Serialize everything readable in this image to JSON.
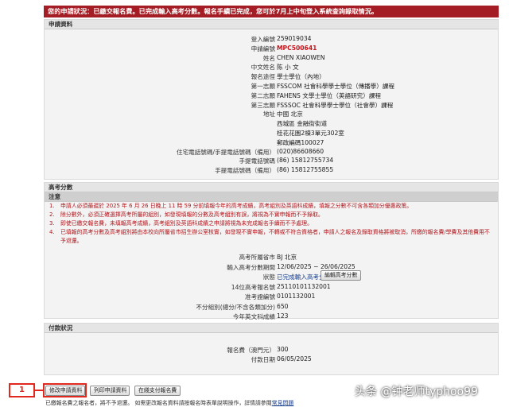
{
  "banner": "您的申請狀況：已繳交報名費。已完成輸入高考分數。報名手續已完成，您可於7月上中旬登入系統查詢錄取情況。",
  "application": {
    "header": "申請資料",
    "rows": [
      {
        "label": "登入編號",
        "value": "259019034"
      },
      {
        "label": "申請編號",
        "value": "MPC500641"
      },
      {
        "label": "姓名",
        "value": "CHEN XIAOWEN"
      },
      {
        "label": "中文姓名",
        "value": "陈 小 文"
      },
      {
        "label": "報名途徑",
        "value": "學士學位（內地）"
      },
      {
        "label": "第一志願",
        "value": "FSSCOM 社會科學學士學位（傳播學）課程"
      },
      {
        "label": "第二志願",
        "value": "FAHENS 文學士學位（英語研究）課程"
      },
      {
        "label": "第三志願",
        "value": "FSSSOC 社會科學學士學位（社會學）課程"
      },
      {
        "label": "地址",
        "value": "中國 北京"
      },
      {
        "label": "",
        "value": "西城區 金融街街道"
      },
      {
        "label": "",
        "value": "桂花花園2棟3單元302室"
      },
      {
        "label": "",
        "value": "郵政編碼100027"
      },
      {
        "label": "住宅電話號碼/手提電話號碼（備用）",
        "value": "(020)86608660"
      },
      {
        "label": "手提電話號碼",
        "value": "(86) 15812755734"
      },
      {
        "label": "手提電話號碼（備用）",
        "value": "(86) 15812755855"
      }
    ]
  },
  "gaokao": {
    "header": "高考分數",
    "notes_header": "注意",
    "notes": [
      {
        "num": "1.",
        "text": "申請人必須最遲於 2025 年 6 月 26 日晚上 11 時 59 分前填報今年的高考成績，高考組別及英語科成績，填報之分數不可含各類加分優惠政策。"
      },
      {
        "num": "2.",
        "text": "除分數外，必須正確選擇高考所屬的組別，如發現填報的分數及高考組別有誤，將視為不實申報而不予錄取。"
      },
      {
        "num": "3.",
        "text": "即使已繳交報名費，未填報高考成績，高考組別及英語科成績之申請將視為未完成報名手續而不予處理。"
      },
      {
        "num": "4.",
        "text": "已填報的高考分數及高考組別將由本校向所屬省市招生辦公室核實，如發現不實申報，不轉或不符合資格者，申請人之報名及錄取資格將被取消，所繳的報名費/學費及其他費用不予退還。"
      }
    ],
    "rows": [
      {
        "label": "高考所屬省市",
        "value": "BJ 北京"
      },
      {
        "label": "輸入高考分數期間",
        "value": "12/06/2025 ~ 26/06/2025"
      },
      {
        "label": "狀態",
        "value": "已完成輸入高考分數"
      },
      {
        "label": "14位高考報名號",
        "value": "25110101132001"
      },
      {
        "label": "准考證編號",
        "value": "0101132001"
      },
      {
        "label": "不分組別(總分/不含各類加分)",
        "value": "650"
      },
      {
        "label": "今年英文科成績",
        "value": "123"
      }
    ],
    "edit_button": "編輯高考分數"
  },
  "payment": {
    "header": "付款狀況",
    "rows": [
      {
        "label": "報名費（澳門元）",
        "value": "300"
      },
      {
        "label": "付款日期",
        "value": "06/05/2025"
      }
    ]
  },
  "buttons": {
    "edit_application": "修改申請資料",
    "print_application": "列印申請資料",
    "online_payment": "在綫支付報名費"
  },
  "footer": {
    "text": "已繳報名費之報名者，將不予退還。 如需更改報名資料請按報名時表單說明操作，詳情請參閱",
    "link": "常見問題"
  },
  "callout_label": "1",
  "watermark": "头条 @钟老师typhoo99",
  "colors": {
    "banner": "#a51d24",
    "note_text": "#b3151b",
    "callout": "#e0281f",
    "link": "#1a3f8f"
  }
}
